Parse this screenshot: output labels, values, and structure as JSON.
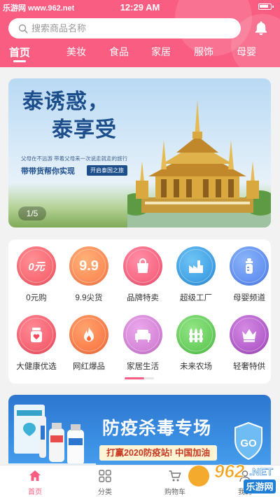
{
  "status_bar": {
    "watermark": "乐游网 www.962.net",
    "time": "12:29 AM"
  },
  "search": {
    "placeholder": "搜索商品名称"
  },
  "tabs": [
    {
      "label": "首页"
    },
    {
      "label": "美妆"
    },
    {
      "label": "食品"
    },
    {
      "label": "家居"
    },
    {
      "label": "服饰"
    },
    {
      "label": "母婴"
    }
  ],
  "banner": {
    "title_line1": "泰诱惑，",
    "title_line2": "泰享受",
    "subtitle": "父母在不远游 带着父母来一次说走就走的旅行",
    "slogan": "带带货帮你实现",
    "button": "开启泰国之旅",
    "pager": "1/5"
  },
  "categories": [
    {
      "label": "0元购",
      "icon": "zero-yuan-icon",
      "glyph": "0元",
      "color": "#fb6b72"
    },
    {
      "label": "9.9尖货",
      "icon": "nine-nine-icon",
      "glyph": "9.9",
      "color": "#fc8a58"
    },
    {
      "label": "品牌特卖",
      "icon": "shopping-bag-icon",
      "glyph": "",
      "color": "#f95d82"
    },
    {
      "label": "超级工厂",
      "icon": "factory-icon",
      "glyph": "",
      "color": "#3aa3e8"
    },
    {
      "label": "母婴频道",
      "icon": "baby-bottle-icon",
      "glyph": "",
      "color": "#5d8ef0"
    },
    {
      "label": "大健康优选",
      "icon": "health-icon",
      "glyph": "",
      "color": "#f5586a"
    },
    {
      "label": "网红爆品",
      "icon": "flame-icon",
      "glyph": "",
      "color": "#fb7a45"
    },
    {
      "label": "家居生活",
      "icon": "sofa-icon",
      "glyph": "",
      "color": "#d786d8"
    },
    {
      "label": "未来农场",
      "icon": "fence-icon",
      "glyph": "",
      "color": "#6cd35d"
    },
    {
      "label": "轻奢特供",
      "icon": "crown-icon",
      "glyph": "",
      "color": "#b55acb"
    }
  ],
  "promo": {
    "title": "防疫杀毒专场",
    "subtitle": "打赢2020防疫站! 中国加油",
    "badge": "GO"
  },
  "bottom_nav": [
    {
      "label": "首页",
      "icon": "home-icon"
    },
    {
      "label": "分类",
      "icon": "grid-icon"
    },
    {
      "label": "购物车",
      "icon": "cart-icon"
    },
    {
      "label": "我的",
      "icon": "user-icon"
    }
  ],
  "watermark_br": {
    "logo": "962",
    "domain": ".NET",
    "text": "乐游网"
  },
  "colors": {
    "brand": "#f95d82",
    "promo_blue": "#2d76cf"
  }
}
